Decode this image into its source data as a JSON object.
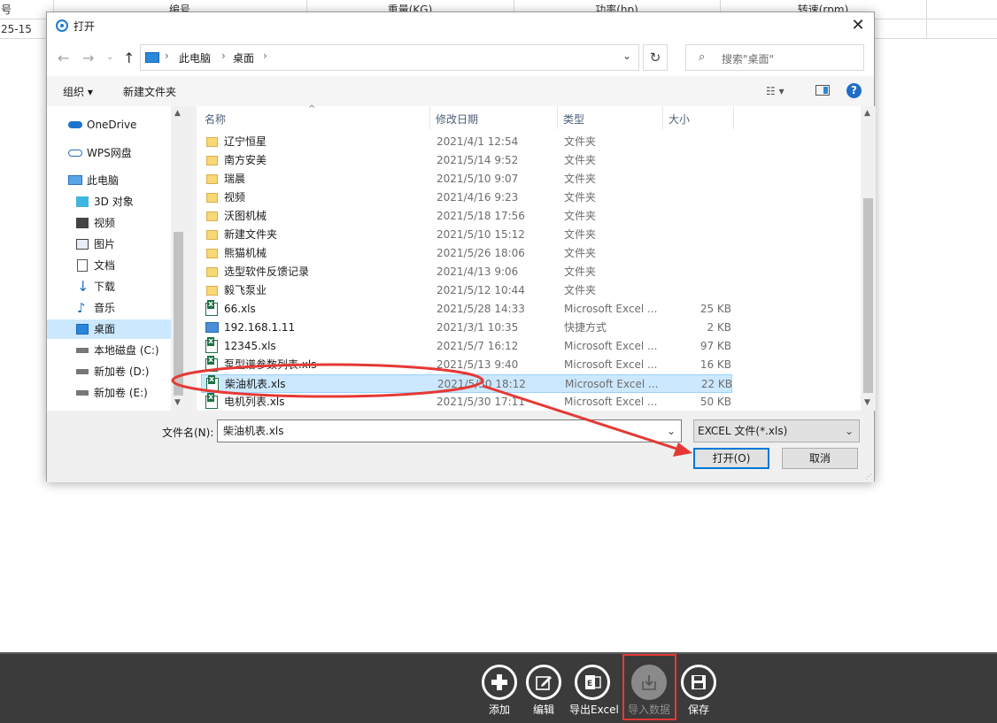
{
  "background_table": {
    "headers": [
      "号",
      "编号",
      "重量(KG)",
      "功率(hp)",
      "转速(rpm)"
    ],
    "row1": [
      "25-15"
    ]
  },
  "dialog": {
    "title": "打开",
    "close_label": "✕",
    "breadcrumb": [
      "此电脑",
      "桌面"
    ],
    "search_placeholder": "搜索\"桌面\"",
    "organize_label": "组织 ▾",
    "new_folder_label": "新建文件夹",
    "help_label": "?",
    "nav_items": [
      {
        "label": "OneDrive",
        "icon": "cloud-icon"
      },
      {
        "label": "WPS网盘",
        "icon": "cloud-outline-icon"
      },
      {
        "label": "此电脑",
        "icon": "computer-icon"
      },
      {
        "label": "3D 对象",
        "icon": "cube-icon"
      },
      {
        "label": "视频",
        "icon": "video-icon"
      },
      {
        "label": "图片",
        "icon": "picture-icon"
      },
      {
        "label": "文档",
        "icon": "document-icon"
      },
      {
        "label": "下载",
        "icon": "download-icon"
      },
      {
        "label": "音乐",
        "icon": "music-icon"
      },
      {
        "label": "桌面",
        "icon": "desktop-icon"
      },
      {
        "label": "本地磁盘 (C:)",
        "icon": "drive-icon"
      },
      {
        "label": "新加卷 (D:)",
        "icon": "drive-icon"
      },
      {
        "label": "新加卷 (E:)",
        "icon": "drive-icon"
      }
    ],
    "columns": {
      "name": "名称",
      "date": "修改日期",
      "type": "类型",
      "size": "大小"
    },
    "files": [
      {
        "name": "辽宁恒星",
        "date": "2021/4/1 12:54",
        "type": "文件夹",
        "size": "",
        "kind": "folder"
      },
      {
        "name": "南方安美",
        "date": "2021/5/14 9:52",
        "type": "文件夹",
        "size": "",
        "kind": "folder"
      },
      {
        "name": "瑞晨",
        "date": "2021/5/10 9:07",
        "type": "文件夹",
        "size": "",
        "kind": "folder"
      },
      {
        "name": "视频",
        "date": "2021/4/16 9:23",
        "type": "文件夹",
        "size": "",
        "kind": "folder"
      },
      {
        "name": "沃图机械",
        "date": "2021/5/18 17:56",
        "type": "文件夹",
        "size": "",
        "kind": "folder"
      },
      {
        "name": "新建文件夹",
        "date": "2021/5/10 15:12",
        "type": "文件夹",
        "size": "",
        "kind": "folder"
      },
      {
        "name": "熊猫机械",
        "date": "2021/5/26 18:06",
        "type": "文件夹",
        "size": "",
        "kind": "folder"
      },
      {
        "name": "选型软件反馈记录",
        "date": "2021/4/13 9:06",
        "type": "文件夹",
        "size": "",
        "kind": "folder"
      },
      {
        "name": "毅飞泵业",
        "date": "2021/5/12 10:44",
        "type": "文件夹",
        "size": "",
        "kind": "folder"
      },
      {
        "name": "66.xls",
        "date": "2021/5/28 14:33",
        "type": "Microsoft Excel ...",
        "size": "25 KB",
        "kind": "xls"
      },
      {
        "name": "192.168.1.11",
        "date": "2021/3/1 10:35",
        "type": "快捷方式",
        "size": "2 KB",
        "kind": "lnk"
      },
      {
        "name": "12345.xls",
        "date": "2021/5/7 16:12",
        "type": "Microsoft Excel ...",
        "size": "97 KB",
        "kind": "xls"
      },
      {
        "name": "泵型谱参数列表.xls",
        "date": "2021/5/13 9:40",
        "type": "Microsoft Excel ...",
        "size": "16 KB",
        "kind": "xls"
      },
      {
        "name": "柴油机表.xls",
        "date": "2021/5/30 18:12",
        "type": "Microsoft Excel ...",
        "size": "22 KB",
        "kind": "xls",
        "selected": true
      },
      {
        "name": "电机列表.xls",
        "date": "2021/5/30 17:11",
        "type": "Microsoft Excel ...",
        "size": "50 KB",
        "kind": "xls"
      }
    ],
    "filename_label": "文件名(N):",
    "filename_value": "柴油机表.xls",
    "filetype_value": "EXCEL 文件(*.xls)",
    "open_label": "打开(O)",
    "cancel_label": "取消"
  },
  "toolbar": {
    "buttons": [
      {
        "label": "添加",
        "icon": "plus-icon",
        "enabled": true
      },
      {
        "label": "编辑",
        "icon": "edit-icon",
        "enabled": true
      },
      {
        "label": "导出Excel",
        "icon": "excel-export-icon",
        "enabled": true
      },
      {
        "label": "导入数据",
        "icon": "import-icon",
        "enabled": false
      },
      {
        "label": "保存",
        "icon": "save-icon",
        "enabled": true
      }
    ]
  },
  "annotations": {
    "highlight_color": "#e53935"
  },
  "colors": {
    "selection": "#cce8ff",
    "accent": "#0078d7",
    "toolbar_bg": "#3b3b3b"
  }
}
